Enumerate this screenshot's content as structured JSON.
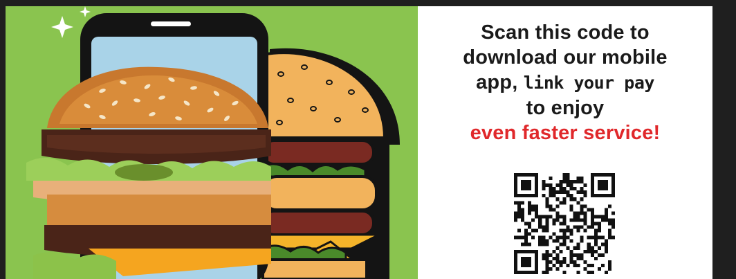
{
  "promo": {
    "background_color": "#8ac44f",
    "image_subject": "burger-phone-illustration"
  },
  "info": {
    "line_1": "Scan this code to",
    "line_2": "download our mobile",
    "line_3_prefix": "app,",
    "line_3_emphasis": "link your pay",
    "line_4": "to enjoy",
    "line_5": "even faster service!",
    "accent_color": "#e0282b",
    "text_color": "#1a1a1a"
  },
  "qr": {
    "icon": "qr-code-icon"
  }
}
